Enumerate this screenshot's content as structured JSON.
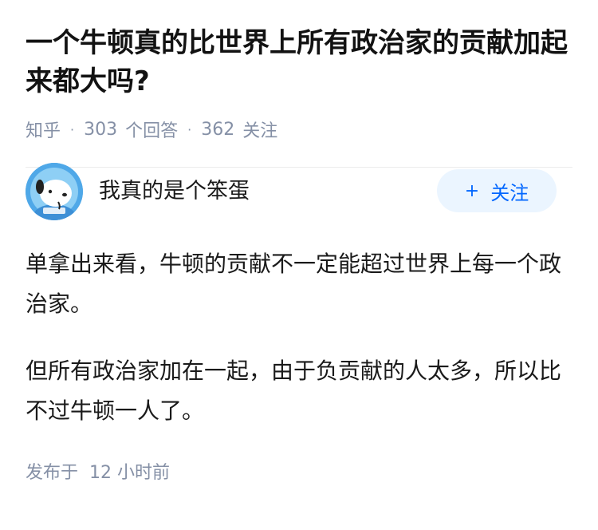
{
  "question": {
    "title": "一个牛顿真的比世界上所有政治家的贡献加起来都大吗?",
    "source": "知乎",
    "answers_count": "303",
    "answers_label": "个回答",
    "followers_count": "362",
    "followers_label": "关注"
  },
  "answer": {
    "author_name": "我真的是个笨蛋",
    "avatar_icon": "cartoon-dog-avatar-icon",
    "follow_button": {
      "plus": "+",
      "label": "关注"
    },
    "paragraphs": [
      "单拿出来看，牛顿的贡献不一定能超过世界上每一个政治家。",
      "但所有政治家加在一起，由于负贡献的人太多，所以比不过牛顿一人了。"
    ],
    "publish_label": "发布于",
    "publish_time": "12 小时前"
  },
  "colors": {
    "meta_gray": "#8590a6",
    "accent_blue": "#0066ff",
    "button_bg": "#ebf5ff",
    "avatar_bg": "#4fa8e8"
  }
}
